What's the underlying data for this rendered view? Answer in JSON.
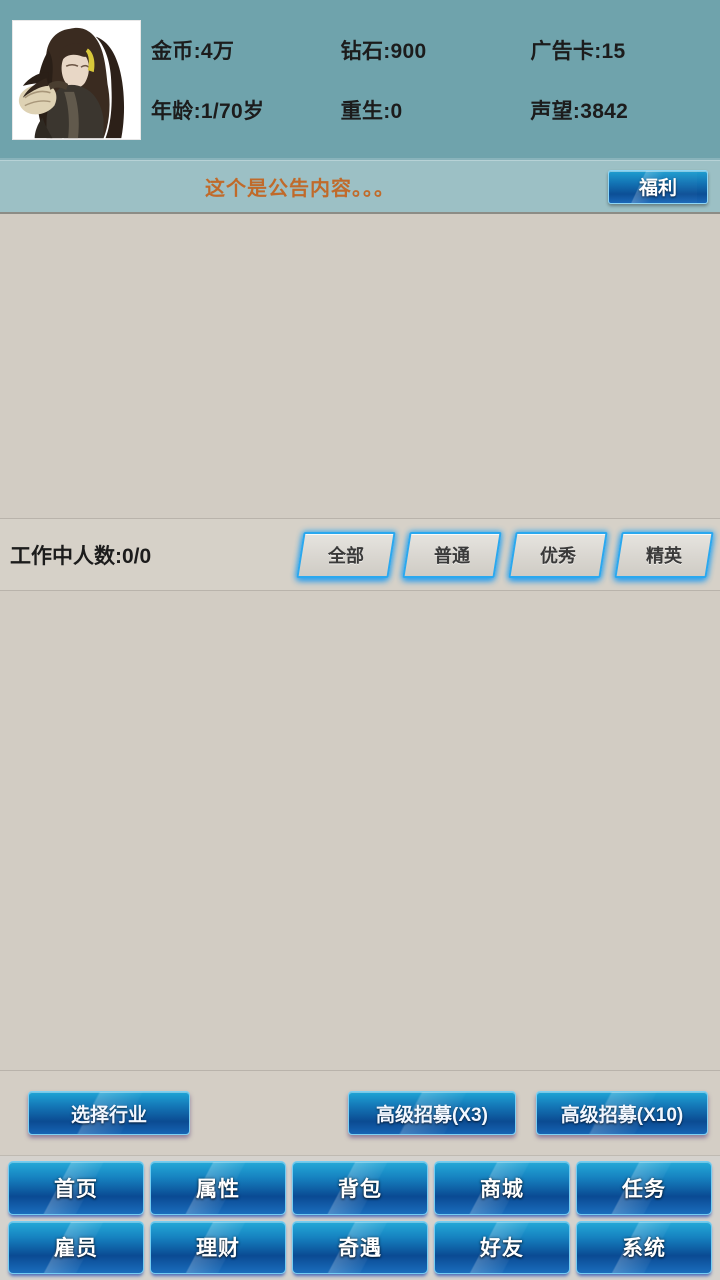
{
  "header": {
    "avatar_name": "character-portrait",
    "stats": [
      {
        "id": "gold",
        "text": "金币:4万"
      },
      {
        "id": "diamond",
        "text": "钻石:900"
      },
      {
        "id": "ad-card",
        "text": "广告卡:15"
      },
      {
        "id": "age",
        "text": "年龄:1/70岁"
      },
      {
        "id": "rebirth",
        "text": "重生:0"
      },
      {
        "id": "reputation",
        "text": "声望:3842"
      }
    ]
  },
  "announcement": {
    "text": "这个是公告内容。。。",
    "welfare_label": "福利"
  },
  "filter_bar": {
    "work_count_label": "工作中人数:0/0",
    "tabs": [
      {
        "id": "all",
        "label": "全部"
      },
      {
        "id": "normal",
        "label": "普通"
      },
      {
        "id": "good",
        "label": "优秀"
      },
      {
        "id": "elite",
        "label": "精英"
      }
    ]
  },
  "action_bar": {
    "industry_label": "选择行业",
    "recruit_x3_label": "高级招募(X3)",
    "recruit_x10_label": "高级招募(X10)"
  },
  "bottom_nav": {
    "items": [
      {
        "id": "home",
        "label": "首页"
      },
      {
        "id": "attribute",
        "label": "属性"
      },
      {
        "id": "backpack",
        "label": "背包"
      },
      {
        "id": "shop",
        "label": "商城"
      },
      {
        "id": "quest",
        "label": "任务"
      },
      {
        "id": "employee",
        "label": "雇员"
      },
      {
        "id": "finance",
        "label": "理财"
      },
      {
        "id": "adventure",
        "label": "奇遇"
      },
      {
        "id": "friends",
        "label": "好友"
      },
      {
        "id": "system",
        "label": "系统"
      }
    ]
  },
  "colors": {
    "header_bg": "#6fa3ac",
    "announce_bg": "#9cc0c5",
    "announce_text": "#c06a2a",
    "panel_bg": "#d2ccc3",
    "nav_bg": "#d5d2cd",
    "button_blue": "#1476b6",
    "tab_glow": "#2aa8ef"
  }
}
